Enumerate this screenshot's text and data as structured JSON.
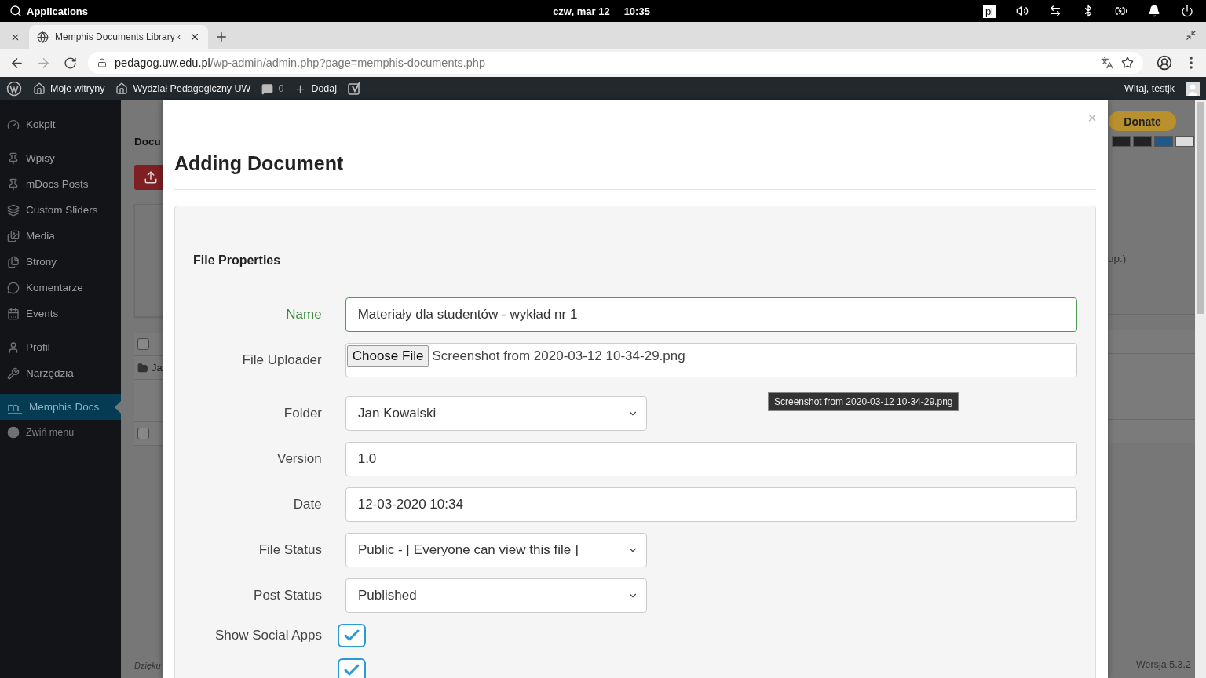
{
  "system_bar": {
    "menu": "Applications",
    "date": "czw, mar 12",
    "time": "10:35",
    "keyboard_layout": "pl"
  },
  "browser": {
    "tabs": [
      {
        "title": "Memphis Documents Library ‹",
        "selected": true
      }
    ],
    "address": {
      "host": "pedagog.uw.edu.pl",
      "path": "/wp-admin/admin.php?page=memphis-documents.php"
    }
  },
  "admin_bar": {
    "items": [
      {
        "label": "Moje witryny"
      },
      {
        "label": "Wydział Pedagogiczny UW"
      },
      {
        "label": "0"
      },
      {
        "label": "Dodaj"
      }
    ],
    "greeting": "Witaj, testjk"
  },
  "sidebar": {
    "groups": [
      {
        "items": [
          {
            "label": "Kokpit",
            "selected": false
          }
        ]
      },
      {
        "items": [
          {
            "label": "Wpisy",
            "selected": false
          },
          {
            "label": "mDocs Posts",
            "selected": false
          },
          {
            "label": "Custom Sliders",
            "selected": false
          },
          {
            "label": "Media",
            "selected": false
          },
          {
            "label": "Strony",
            "selected": false
          },
          {
            "label": "Komentarze",
            "selected": false
          },
          {
            "label": "Events",
            "selected": false
          }
        ]
      },
      {
        "items": [
          {
            "label": "Profil",
            "selected": false
          },
          {
            "label": "Narzędzia",
            "selected": false
          }
        ]
      },
      {
        "items": [
          {
            "label": "Memphis Docs",
            "selected": true
          }
        ]
      }
    ],
    "collapse": "Zwiń menu"
  },
  "background_page": {
    "heading": "Docu",
    "checkboxes": [
      {
        "checked": false
      },
      {
        "checked": false
      }
    ],
    "folder_row": "Ja",
    "footer": "Dzięku",
    "donate": "Donate",
    "note": "up.)",
    "version": "Wersja 5.3.2"
  },
  "modal": {
    "title": "Adding Document",
    "close": "×",
    "section": "File Properties",
    "fields": [
      {
        "kind": "text",
        "label": "Name",
        "value": "Materiały dla studentów - wykład nr 1",
        "valid": true
      },
      {
        "kind": "file",
        "label": "File Uploader",
        "button": "Choose File",
        "value": "Screenshot from 2020-03-12 10-34-29.png"
      },
      {
        "kind": "select",
        "label": "Folder",
        "value": "Jan Kowalski"
      },
      {
        "kind": "text",
        "label": "Version",
        "value": "1.0",
        "valid": false
      },
      {
        "kind": "text",
        "label": "Date",
        "value": "12-03-2020 10:34",
        "valid": false
      },
      {
        "kind": "select",
        "label": "File Status",
        "value": "Public - [ Everyone can view this file ]"
      },
      {
        "kind": "select",
        "label": "Post Status",
        "value": "Published"
      },
      {
        "kind": "checkbox",
        "label": "Show Social Apps",
        "checked": true
      },
      {
        "kind": "checkbox",
        "checked": true
      }
    ],
    "tooltip": "Screenshot from 2020-03-12 10-34-29.png"
  }
}
